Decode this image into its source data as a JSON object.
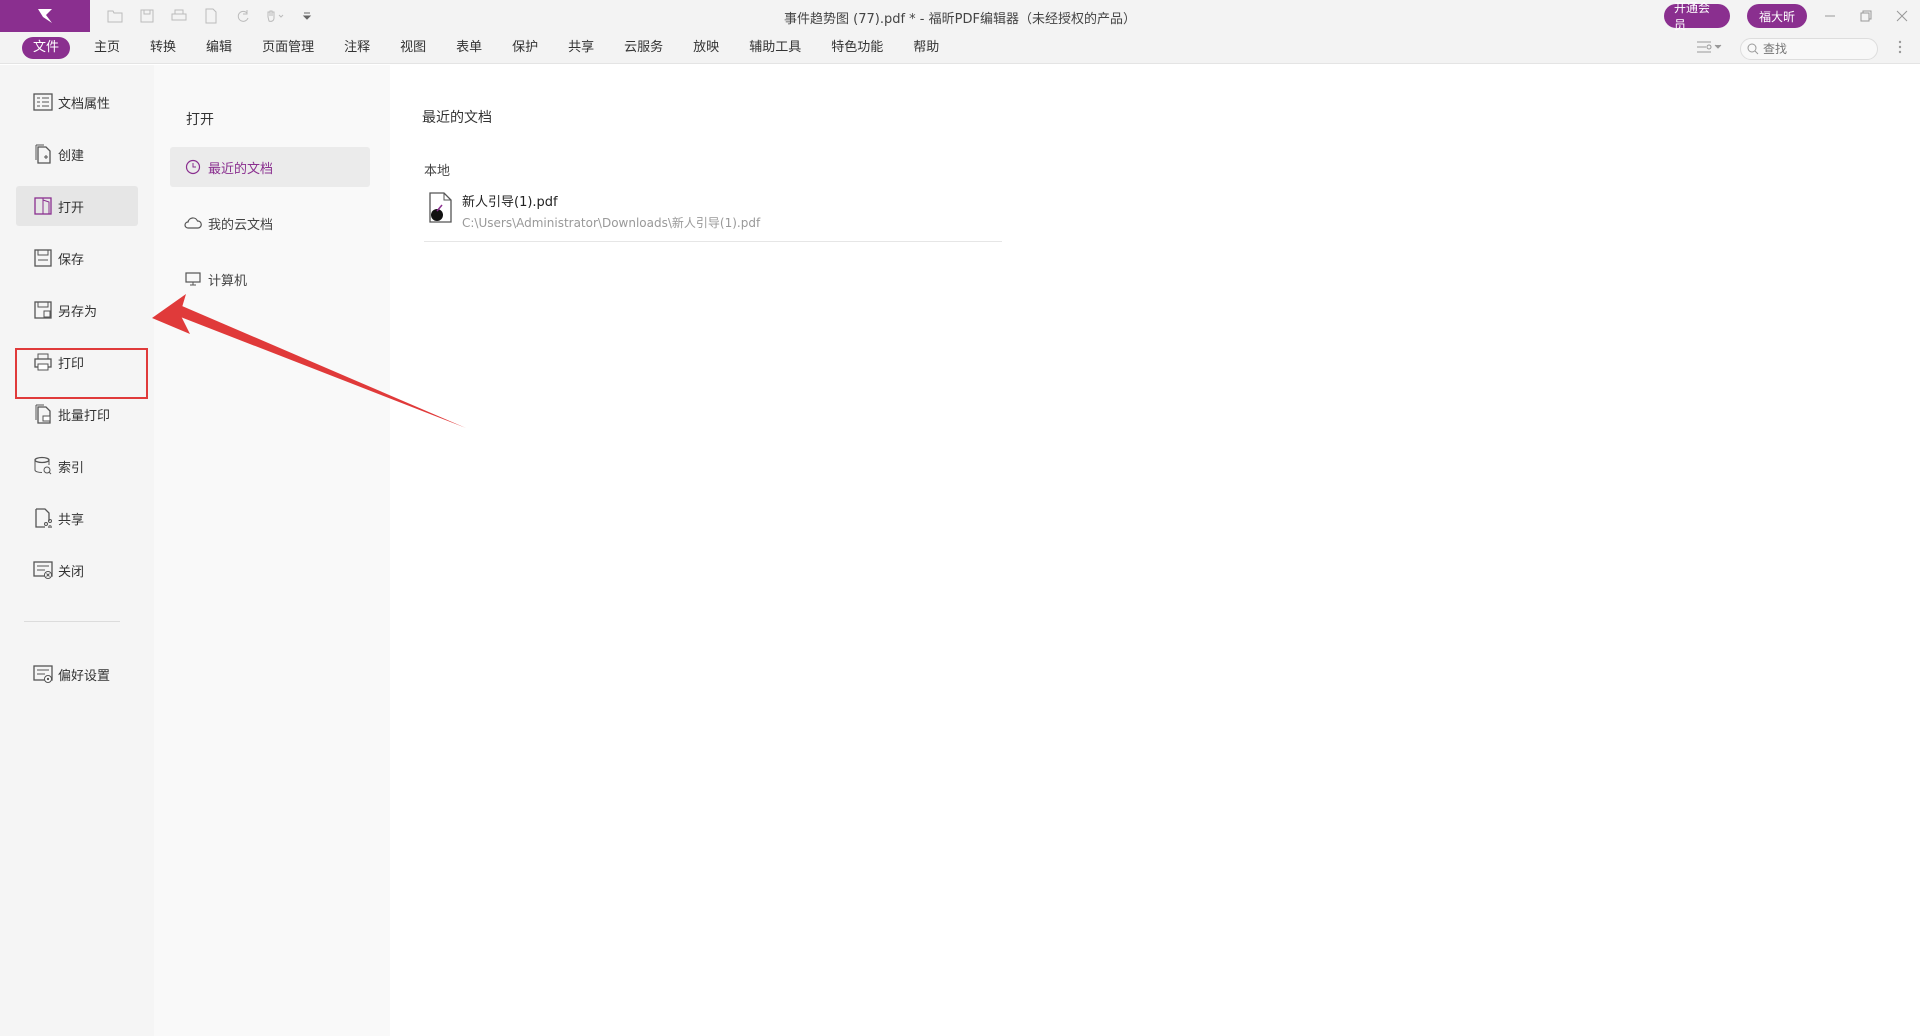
{
  "window": {
    "title": "事件趋势图 (77).pdf * - 福昕PDF编辑器（未经授权的产品）",
    "vip_label": "开通会员",
    "user_label": "福大昕"
  },
  "menubar": {
    "items": [
      "文件",
      "主页",
      "转换",
      "编辑",
      "页面管理",
      "注释",
      "视图",
      "表单",
      "保护",
      "共享",
      "云服务",
      "放映",
      "辅助工具",
      "特色功能",
      "帮助"
    ],
    "search_placeholder": "查找"
  },
  "sidebar": {
    "items": [
      {
        "label": "文档属性",
        "icon": "document-properties-icon"
      },
      {
        "label": "创建",
        "icon": "create-icon"
      },
      {
        "label": "打开",
        "icon": "open-icon"
      },
      {
        "label": "保存",
        "icon": "save-icon"
      },
      {
        "label": "另存为",
        "icon": "save-as-icon"
      },
      {
        "label": "打印",
        "icon": "print-icon"
      },
      {
        "label": "批量打印",
        "icon": "batch-print-icon"
      },
      {
        "label": "索引",
        "icon": "index-icon"
      },
      {
        "label": "共享",
        "icon": "share-icon"
      },
      {
        "label": "关闭",
        "icon": "close-doc-icon"
      }
    ],
    "preferences": "偏好设置"
  },
  "open_panel": {
    "title": "打开",
    "items": [
      {
        "label": "最近的文档",
        "icon": "clock-icon"
      },
      {
        "label": "我的云文档",
        "icon": "cloud-icon"
      },
      {
        "label": "计算机",
        "icon": "computer-icon"
      }
    ]
  },
  "recent": {
    "title": "最近的文档",
    "local_label": "本地",
    "files": [
      {
        "name": "新人引导(1).pdf",
        "path": "C:\\Users\\Administrator\\Downloads\\新人引导(1).pdf"
      }
    ]
  },
  "colors": {
    "accent": "#8a2f8f",
    "annotation": "#e03a3a"
  }
}
